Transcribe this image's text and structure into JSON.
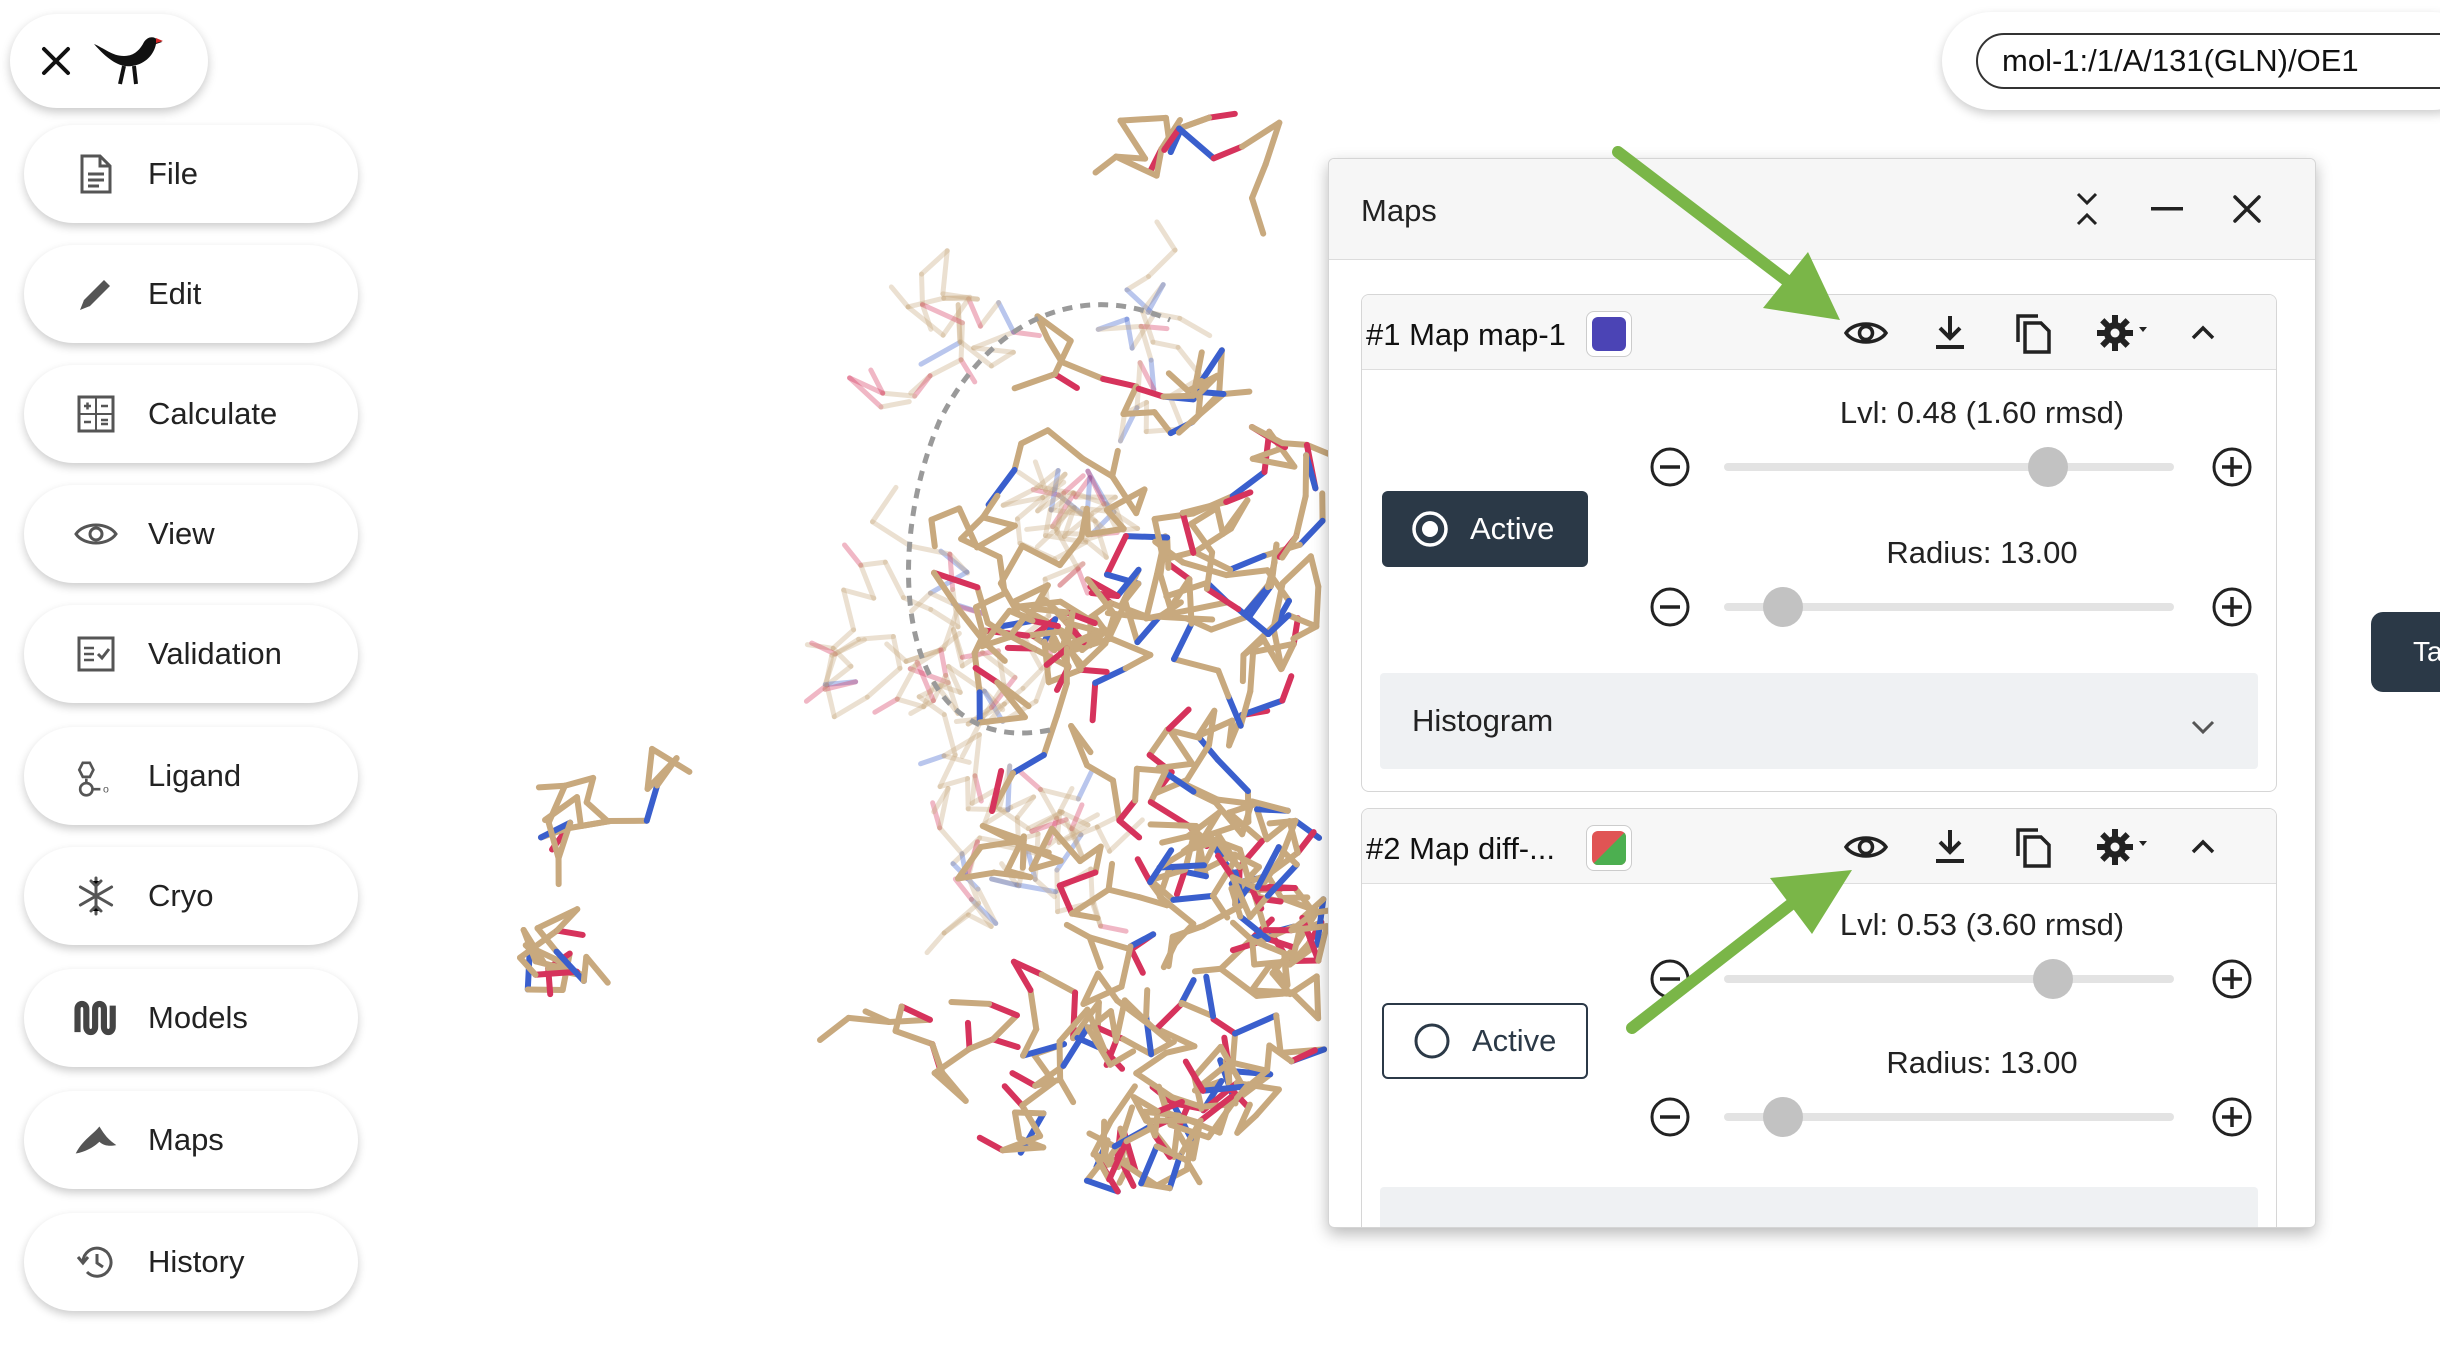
{
  "sidebar": {
    "items": [
      {
        "label": "File",
        "icon": "file-icon"
      },
      {
        "label": "Edit",
        "icon": "pencil-icon"
      },
      {
        "label": "Calculate",
        "icon": "calculator-icon"
      },
      {
        "label": "View",
        "icon": "eye-icon"
      },
      {
        "label": "Validation",
        "icon": "checklist-icon"
      },
      {
        "label": "Ligand",
        "icon": "ligand-icon"
      },
      {
        "label": "Cryo",
        "icon": "snowflake-icon"
      },
      {
        "label": "Models",
        "icon": "models-icon"
      },
      {
        "label": "Maps",
        "icon": "maps-icon"
      },
      {
        "label": "History",
        "icon": "history-icon"
      }
    ]
  },
  "selection": {
    "value": "mol-1:/1/A/131(GLN)/OE1"
  },
  "edge_tab": {
    "label": "Ta"
  },
  "maps_panel": {
    "title": "Maps",
    "maps": [
      {
        "title": "#1 Map map-1",
        "color": "#4b44b5",
        "active_label": "Active",
        "active": true,
        "level_label": "Lvl: 0.48 (1.60 rmsd)",
        "level_fraction": 0.72,
        "radius_label": "Radius: 13.00",
        "radius_fraction": 0.13,
        "histogram_label": "Histogram"
      },
      {
        "title": "#2 Map diff-...",
        "color_positive": "#4caf50",
        "color_negative": "#e05454",
        "active_label": "Active",
        "active": false,
        "level_label": "Lvl: 0.53 (3.60 rmsd)",
        "level_fraction": 0.73,
        "radius_label": "Radius: 13.00",
        "radius_fraction": 0.13
      }
    ]
  },
  "colors": {
    "accent_dark": "#2b3947",
    "annotation_arrow": "#7ab648",
    "carbon": "#c8a97e",
    "nitrogen": "#3a5fcd",
    "oxygen": "#d6335c"
  }
}
